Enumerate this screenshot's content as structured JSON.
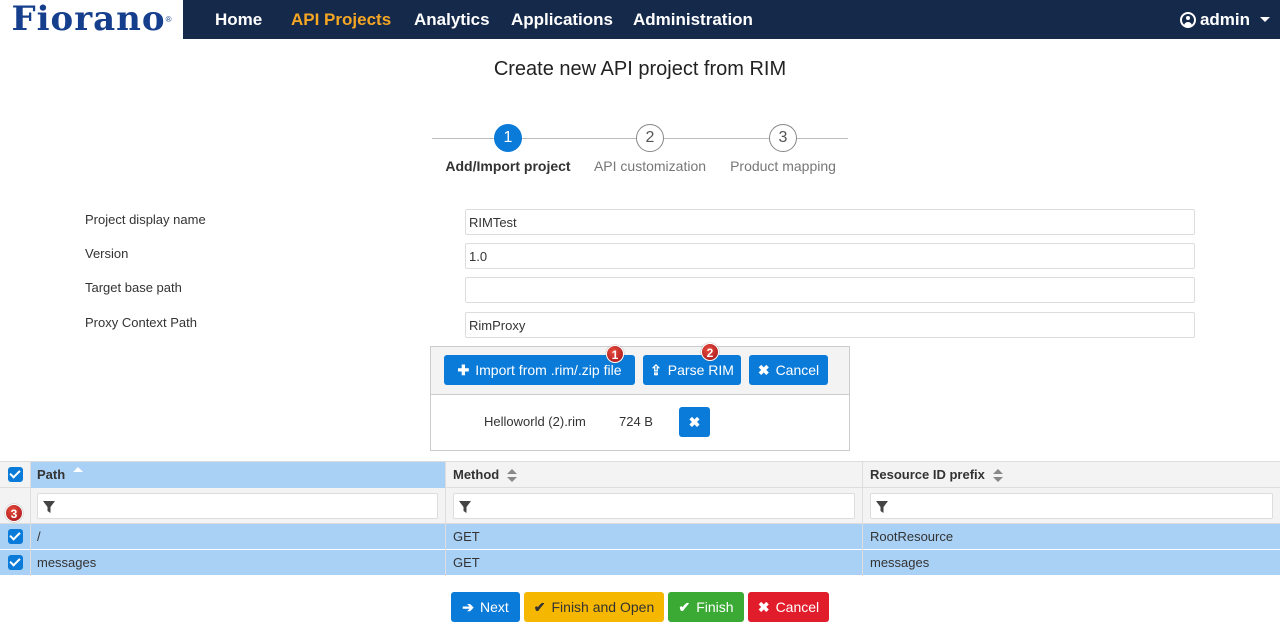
{
  "navbar": {
    "logo": "Fiorano",
    "items": [
      {
        "label": "Home",
        "active": false
      },
      {
        "label": "API Projects",
        "active": true
      },
      {
        "label": "Analytics",
        "active": false
      },
      {
        "label": "Applications",
        "active": false
      },
      {
        "label": "Administration",
        "active": false
      }
    ],
    "user": "admin"
  },
  "page_title": "Create new API project from RIM",
  "stepper": {
    "steps": [
      {
        "number": "1",
        "label": "Add/Import project",
        "active": true
      },
      {
        "number": "2",
        "label": "API customization",
        "active": false
      },
      {
        "number": "3",
        "label": "Product mapping",
        "active": false
      }
    ]
  },
  "form": {
    "display_name": {
      "label": "Project display name",
      "value": "RIMTest"
    },
    "version": {
      "label": "Version",
      "value": "1.0"
    },
    "target_base_path": {
      "label": "Target base path",
      "value": ""
    },
    "proxy_context_path": {
      "label": "Proxy Context Path",
      "value": "RimProxy"
    }
  },
  "import_panel": {
    "import_button": "Import from .rim/.zip file",
    "parse_button": "Parse RIM",
    "cancel_button": "Cancel",
    "markers": [
      "1",
      "2",
      "3"
    ],
    "file": {
      "name": "Helloworld (2).rim",
      "size": "724 B"
    }
  },
  "table": {
    "columns": [
      {
        "label": "Path",
        "sort": "ascending"
      },
      {
        "label": "Method",
        "sort": "none"
      },
      {
        "label": "Resource ID prefix",
        "sort": "none"
      }
    ],
    "rows": [
      {
        "path": "/",
        "method": "GET",
        "resource_id_prefix": "RootResource",
        "checked": true
      },
      {
        "path": "messages",
        "method": "GET",
        "resource_id_prefix": "messages",
        "checked": true
      }
    ]
  },
  "footer": {
    "next": "Next",
    "finish_and_open": "Finish and Open",
    "finish": "Finish",
    "cancel": "Cancel"
  },
  "colors": {
    "navbar": "#15294b",
    "active_nav": "#f5a623",
    "primary": "#0a7bd8",
    "warning": "#f6b700",
    "success": "#3aaa35",
    "danger": "#e21d2b",
    "selected_row": "#a9d0f5"
  }
}
